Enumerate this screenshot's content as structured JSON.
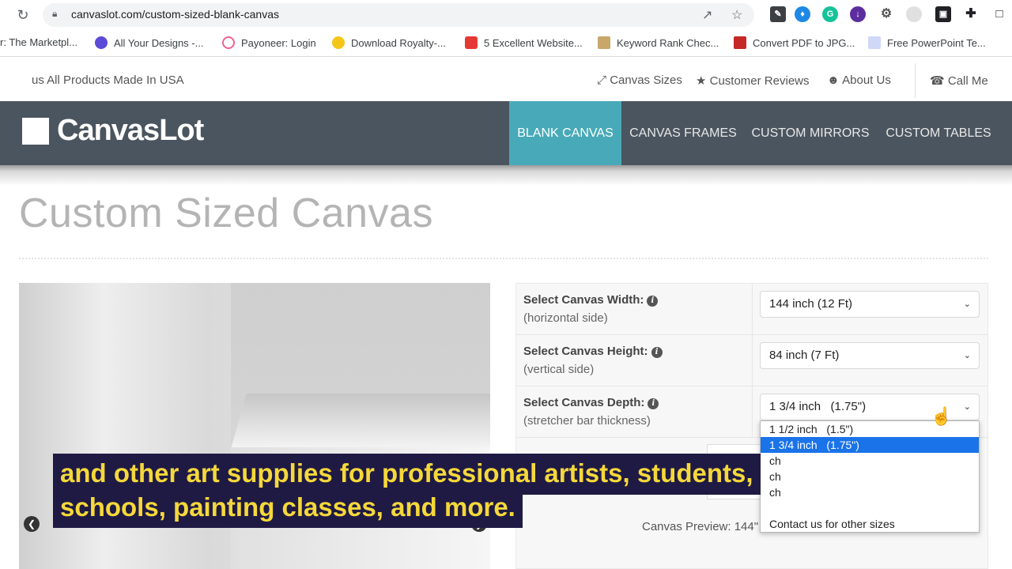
{
  "browser": {
    "url": "canvaslot.com/custom-sized-blank-canvas",
    "bookmarks": [
      "r: The Marketpl...",
      "All Your Designs -...",
      "Payoneer: Login",
      "Download Royalty-...",
      "5 Excellent Website...",
      "Keyword Rank Chec...",
      "Convert PDF to JPG...",
      "Free PowerPoint Te..."
    ]
  },
  "util": {
    "tagline": "us All Products Made In USA",
    "canvas_sizes": "Canvas Sizes",
    "reviews": "Customer Reviews",
    "about": "About Us",
    "call": "Call Me"
  },
  "nav": {
    "logo": "CanvasLot",
    "items": [
      "BLANK CANVAS",
      "CANVAS FRAMES",
      "CUSTOM MIRRORS",
      "CUSTOM TABLES"
    ],
    "active_color": "#48aab8",
    "bar_color": "#4b555f"
  },
  "page": {
    "title": "Custom Sized Canvas"
  },
  "form": {
    "width_label": "Select Canvas Width:",
    "width_sub": "(horizontal side)",
    "width_value": "144 inch (12 Ft)",
    "height_label": "Select Canvas Height:",
    "height_sub": "(vertical side)",
    "height_value": "84 inch (7 Ft)",
    "depth_label": "Select Canvas Depth:",
    "depth_sub": "(stretcher bar thickness)",
    "depth_value": "1 3/4 inch   (1.75\")",
    "depth_options": [
      "1 1/2 inch   (1.5\")",
      "1 3/4 inch   (1.75\")",
      "ch",
      "ch",
      "ch",
      "Contact us for other sizes"
    ],
    "preview_label": "Canvas Preview: 144\""
  },
  "caption": {
    "line1": "and other art supplies for professional artists, students,",
    "line2": "schools, painting classes, and more."
  }
}
